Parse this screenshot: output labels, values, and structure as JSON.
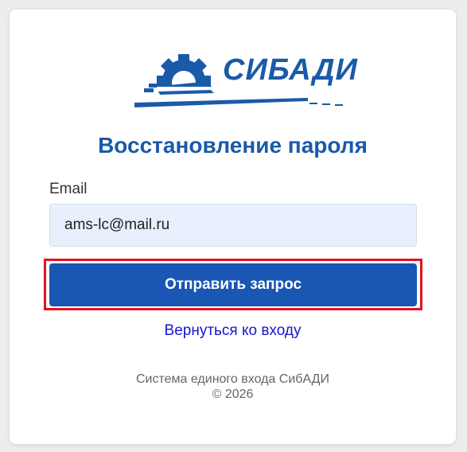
{
  "logo": {
    "text": "СИБАДИ",
    "icon": "gear-road-logo-icon",
    "color": "#1a5aa8"
  },
  "title": "Восстановление пароля",
  "form": {
    "email_label": "Email",
    "email_value": "ams-lc@mail.ru",
    "submit_label": "Отправить запрос"
  },
  "back_link": "Вернуться ко входу",
  "footer": {
    "line1": "Система единого входа СибАДИ",
    "line2": "© 2026"
  },
  "colors": {
    "accent": "#1a5aa8",
    "button": "#1a56b3",
    "link": "#1515d6",
    "highlight": "#e0141e",
    "input_bg": "#e8f0fe"
  }
}
